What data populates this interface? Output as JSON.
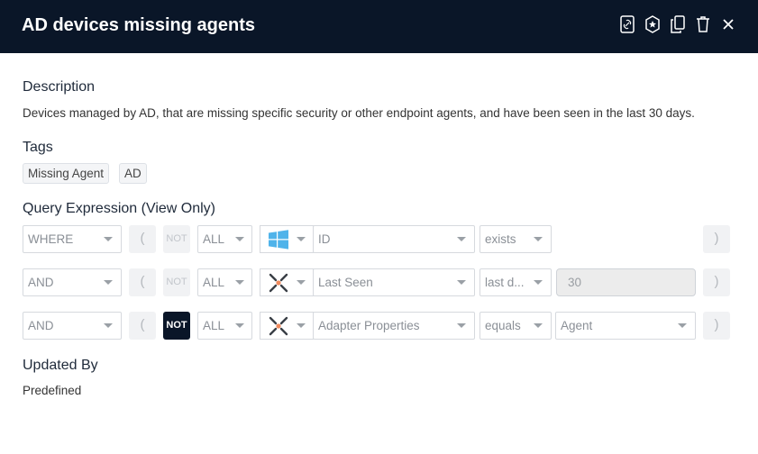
{
  "header": {
    "title": "AD devices missing agents",
    "icons": [
      "link-copy-icon",
      "favorite-badge-icon",
      "duplicate-icon",
      "delete-icon",
      "close-icon"
    ]
  },
  "description": {
    "heading": "Description",
    "text": "Devices managed by AD, that are missing specific security or other endpoint agents, and have been seen in the last 30 days."
  },
  "tags": {
    "heading": "Tags",
    "items": [
      "Missing Agent",
      "AD"
    ]
  },
  "query": {
    "heading": "Query Expression (View Only)",
    "rows": [
      {
        "logic": "WHERE",
        "open_paren": "(",
        "not": "NOT",
        "not_active": false,
        "scope": "ALL",
        "adapter_icon": "windows-icon",
        "field": "ID",
        "operator": "exists",
        "value": "",
        "close_paren": ")"
      },
      {
        "logic": "AND",
        "open_paren": "(",
        "not": "NOT",
        "not_active": false,
        "scope": "ALL",
        "adapter_icon": "aggregated-adapters-icon",
        "field": "Last Seen",
        "operator": "last d...",
        "value": "30",
        "close_paren": ")"
      },
      {
        "logic": "AND",
        "open_paren": "(",
        "not": "NOT",
        "not_active": true,
        "scope": "ALL",
        "adapter_icon": "aggregated-adapters-icon",
        "field": "Adapter Properties",
        "operator": "equals",
        "value": "Agent",
        "close_paren": ")"
      }
    ]
  },
  "updated_by": {
    "heading": "Updated By",
    "value": "Predefined"
  }
}
